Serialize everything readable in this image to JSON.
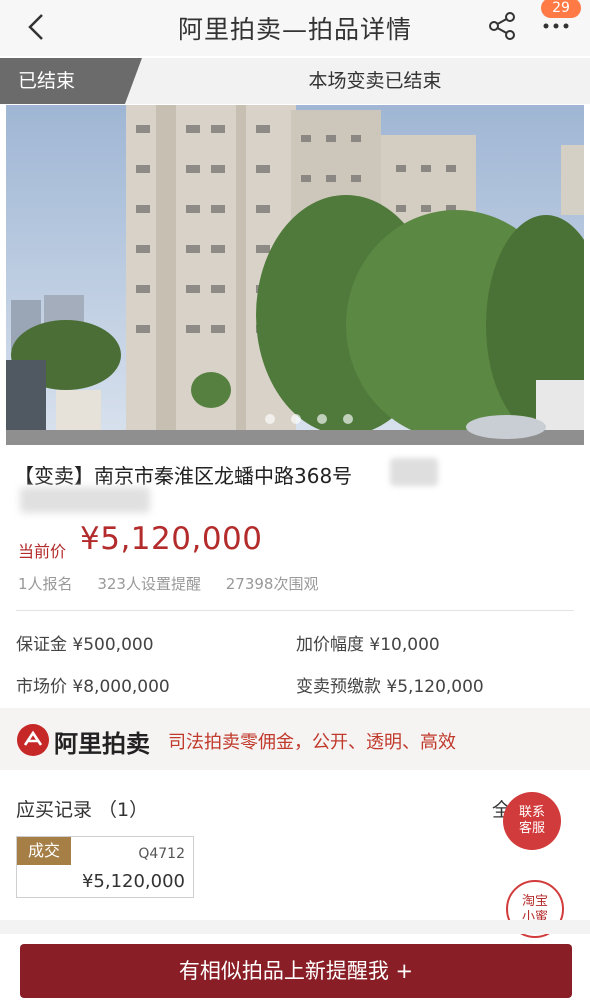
{
  "header": {
    "title": "阿里拍卖—拍品详情",
    "badge_count": "29"
  },
  "status": {
    "tag": "已结束",
    "message": "本场变卖已结束"
  },
  "item": {
    "title": "【变卖】南京市秦淮区龙蟠中路368号"
  },
  "price": {
    "label": "当前价",
    "value": "¥5,120,000"
  },
  "stats": {
    "signups": "1人报名",
    "reminders": "323人设置提醒",
    "views": "27398次围观"
  },
  "info": {
    "deposit": "保证金 ¥500,000",
    "increment": "加价幅度 ¥10,000",
    "market_price": "市场价 ¥8,000,000",
    "prepay": "变卖预缴款 ¥5,120,000"
  },
  "brand": {
    "name": "阿里拍卖",
    "slogan": "司法拍卖零佣金，公开、透明、高效"
  },
  "records": {
    "title": "应买记录 （1）",
    "all_label": "全",
    "items": [
      {
        "tag": "成交",
        "code": "Q4712",
        "amount": "¥5,120,000"
      }
    ]
  },
  "float_buttons": {
    "primary": "联系\n客服",
    "secondary": "淘宝\n小蜜"
  },
  "bottom_button": {
    "label": "有相似拍品上新提醒我 +"
  },
  "colors": {
    "accent": "#b32b2b",
    "button": "#8a1e26",
    "deal_tag": "#a57f46"
  }
}
